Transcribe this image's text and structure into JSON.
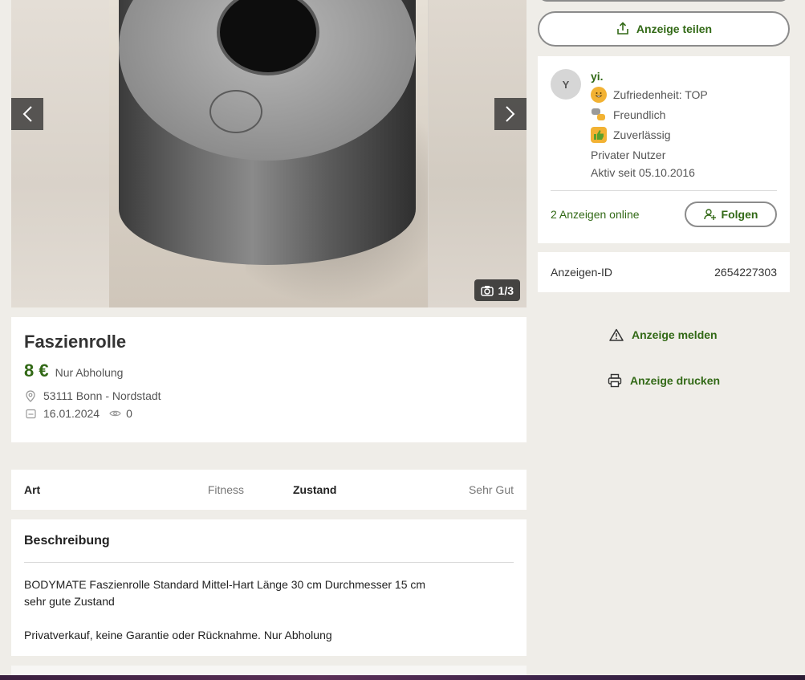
{
  "gallery": {
    "counter": "1/3",
    "prev_label": "‹",
    "next_label": "›"
  },
  "ad": {
    "title": "Faszienrolle",
    "price": "8 €",
    "price_note": "Nur Abholung",
    "location": "53111 Bonn - Nordstadt",
    "date": "16.01.2024",
    "views": "0"
  },
  "details": [
    {
      "label": "Art",
      "value": "Fitness"
    },
    {
      "label": "Zustand",
      "value": "Sehr Gut"
    }
  ],
  "description": {
    "heading": "Beschreibung",
    "lines": [
      "BODYMATE Faszienrolle Standard Mittel-Hart Länge 30 cm Durchmesser 15 cm",
      "sehr gute Zustand",
      "",
      "Privatverkauf, keine Garantie oder Rücknahme. Nur Abholung"
    ]
  },
  "sidebar": {
    "share_label": "Anzeige teilen",
    "seller": {
      "initial": "Y",
      "name": "yi.",
      "badges": [
        {
          "label": "Zufriedenheit: TOP",
          "icon": "smiley-icon",
          "color": "#f2b233"
        },
        {
          "label": "Freundlich",
          "icon": "speech-bubbles-icon",
          "color": "#f2b233"
        },
        {
          "label": "Zuverlässig",
          "icon": "thumbs-up-icon",
          "color": "#f2b233"
        }
      ],
      "type": "Privater Nutzer",
      "since": "Aktiv seit 05.10.2016",
      "ads_online": "2 Anzeigen online",
      "follow_label": "Folgen"
    },
    "ad_id_label": "Anzeigen-ID",
    "ad_id_value": "2654227303",
    "report_label": "Anzeige melden",
    "print_label": "Anzeige drucken"
  },
  "colors": {
    "accent": "#326916",
    "background": "#efede8"
  }
}
